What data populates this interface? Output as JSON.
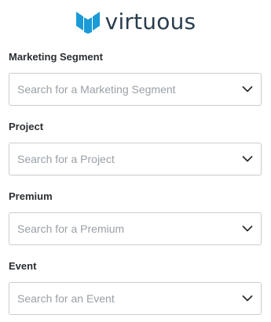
{
  "brand": {
    "logo_text": "virtuous",
    "logo_color": "#1a9bd7",
    "text_color": "#2a3d4e",
    "icon": "virtuous-logo-icon"
  },
  "fields": [
    {
      "label": "Marketing Segment",
      "placeholder": "Search for a Marketing Segment",
      "icon": "chevron-down-icon"
    },
    {
      "label": "Project",
      "placeholder": "Search for a Project",
      "icon": "chevron-down-icon"
    },
    {
      "label": "Premium",
      "placeholder": "Search for a Premium",
      "icon": "chevron-down-icon"
    },
    {
      "label": "Event",
      "placeholder": "Search for an Event",
      "icon": "chevron-down-icon"
    }
  ]
}
